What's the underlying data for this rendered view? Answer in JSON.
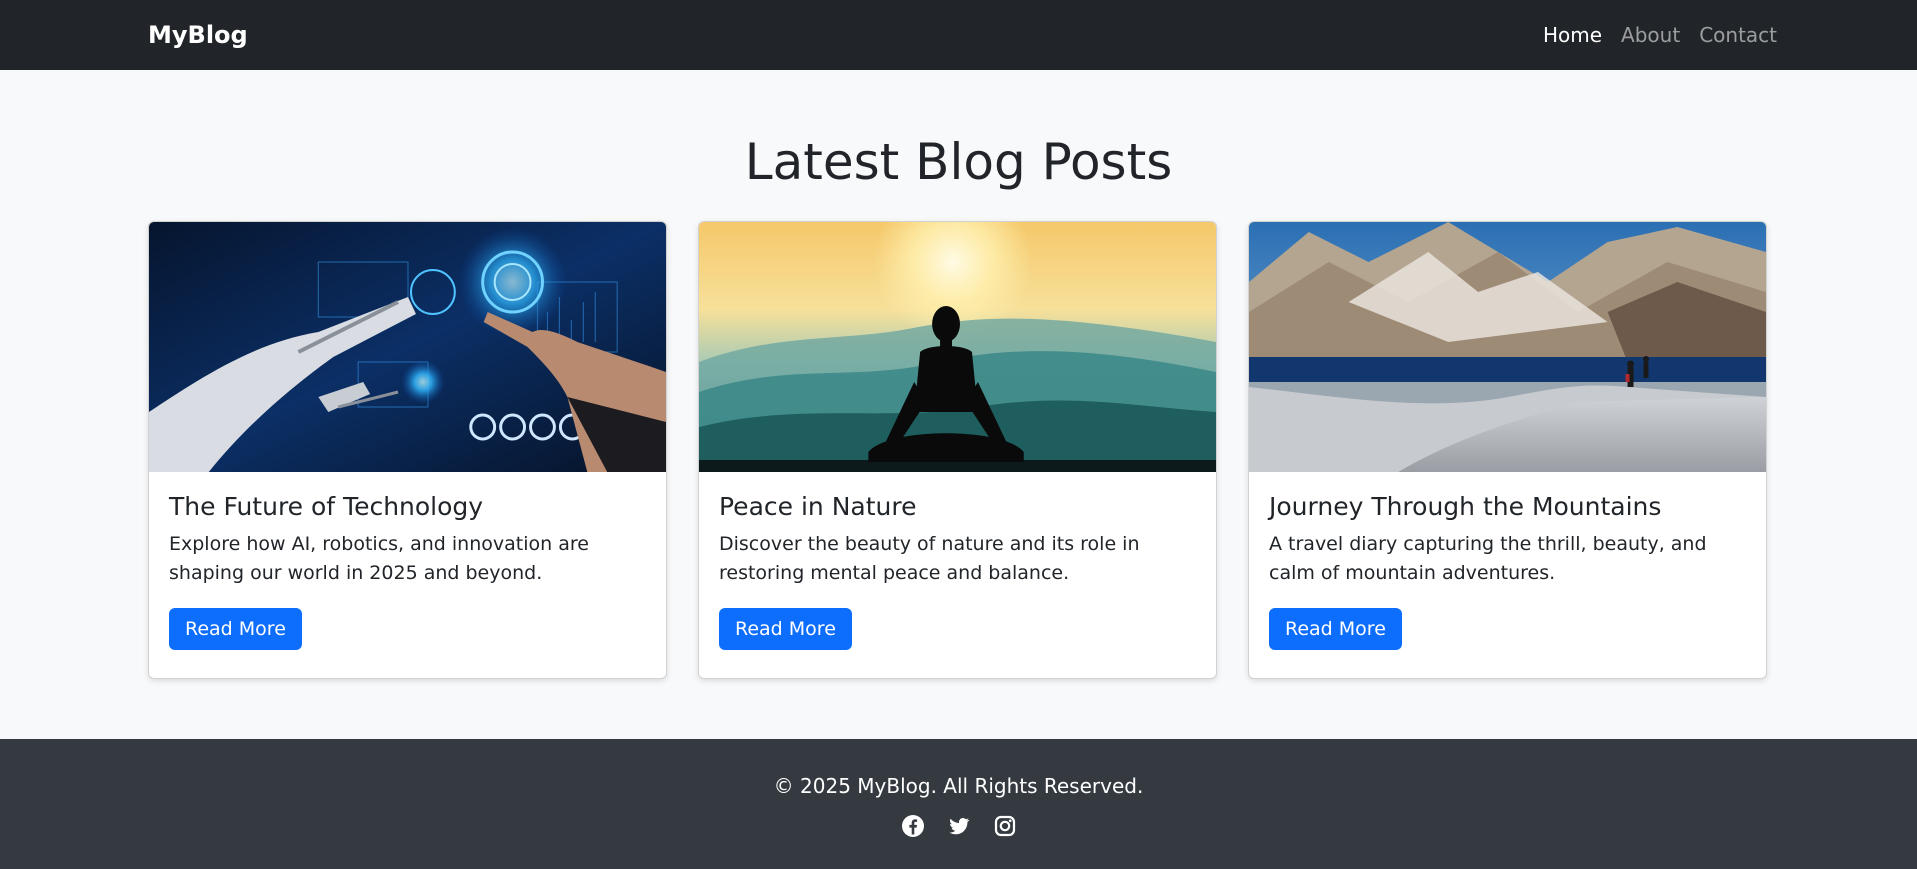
{
  "navbar": {
    "brand": "MyBlog",
    "links": [
      {
        "label": "Home"
      },
      {
        "label": "About"
      },
      {
        "label": "Contact"
      }
    ]
  },
  "main": {
    "title": "Latest Blog Posts",
    "posts": [
      {
        "title": "The Future of Technology",
        "text": "Explore how AI, robotics, and innovation are shaping our world in 2025 and beyond.",
        "button": "Read More",
        "image": "robot-hand-technology-image"
      },
      {
        "title": "Peace in Nature",
        "text": "Discover the beauty of nature and its role in restoring mental peace and balance.",
        "button": "Read More",
        "image": "meditation-silhouette-sunrise-image"
      },
      {
        "title": "Journey Through the Mountains",
        "text": "A travel diary capturing the thrill, beauty, and calm of mountain adventures.",
        "button": "Read More",
        "image": "mountain-lake-hikers-image"
      }
    ]
  },
  "footer": {
    "copyright": "© 2025 MyBlog. All Rights Reserved.",
    "social": [
      "facebook-icon",
      "twitter-icon",
      "instagram-icon"
    ]
  },
  "colors": {
    "navbar": "#212529",
    "footer": "#343a40",
    "primary": "#0d6efd",
    "page_bg": "#f8f9fa"
  }
}
